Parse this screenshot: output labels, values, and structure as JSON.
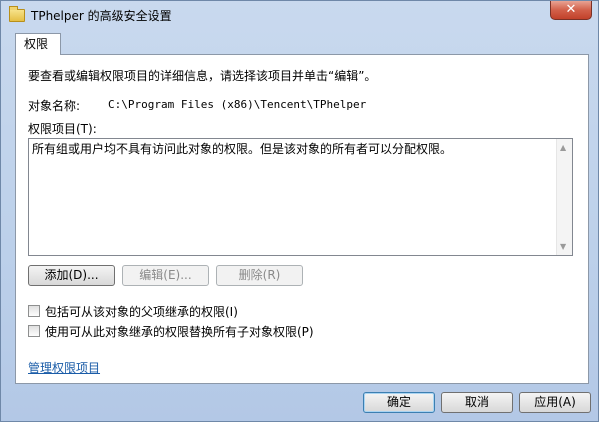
{
  "window": {
    "title": "TPhelper 的高级安全设置",
    "close_glyph": "✕"
  },
  "tabs": [
    {
      "label": "权限"
    }
  ],
  "permissions": {
    "instruction": "要查看或编辑权限项目的详细信息，请选择该项目并单击“编辑”。",
    "object_name_label": "对象名称:",
    "object_name_value": "C:\\Program Files (x86)\\Tencent\\TPhelper",
    "entries_label": "权限项目(T):",
    "entries_message": "所有组或用户均不具有访问此对象的权限。但是该对象的所有者可以分配权限。",
    "add_button": "添加(D)...",
    "edit_button": "编辑(E)...",
    "remove_button": "删除(R)",
    "inherit_checkbox_label": "包括可从该对象的父项继承的权限(I)",
    "inherit_checked": false,
    "replace_checkbox_label": "使用可从此对象继承的权限替换所有子对象权限(P)",
    "replace_checked": false,
    "manage_link": "管理权限项目"
  },
  "footer": {
    "ok_button": "确定",
    "cancel_button": "取消",
    "apply_button": "应用(A)"
  },
  "icons": {
    "folder": "folder-icon",
    "scroll_up": "▲",
    "scroll_down": "▼"
  }
}
